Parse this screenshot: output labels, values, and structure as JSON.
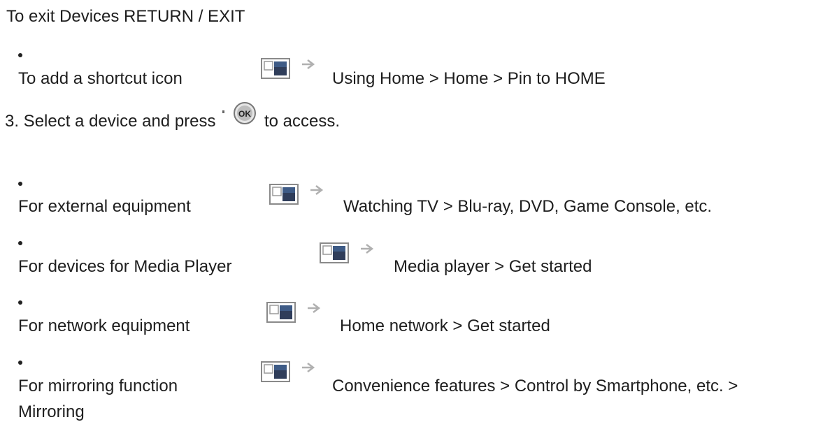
{
  "exit_item": {
    "text": "To exit Devices RETURN / EXIT"
  },
  "shortcut_item": {
    "label": "To add a shortcut icon",
    "ref": "Using Home > Home > Pin to HOME"
  },
  "step3": {
    "before": "3. Select a device and press",
    "after": "to access."
  },
  "items": [
    {
      "label": "For external equipment",
      "ref": "Watching TV > Blu-ray, DVD, Game Console, etc."
    },
    {
      "label": "For devices for Media Player",
      "ref": "Media player > Get started"
    },
    {
      "label": "For network equipment",
      "ref": "Home network > Get started"
    },
    {
      "label": "For mirroring function",
      "ref": "Convenience features > Control by Smartphone, etc. >",
      "ref_cont": "Mirroring"
    }
  ],
  "icons": {
    "reference": "reference-arrow-icon",
    "ok": "ok-button-icon"
  },
  "ok_label": "OK"
}
